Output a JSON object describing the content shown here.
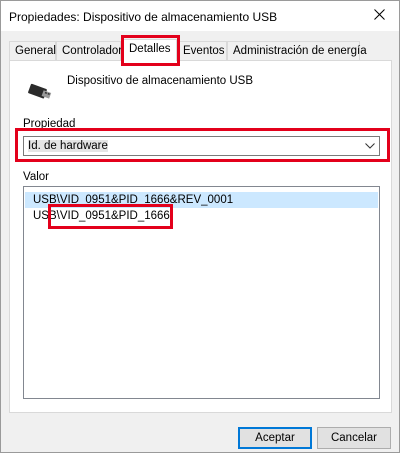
{
  "window": {
    "title": "Propiedades: Dispositivo de almacenamiento USB",
    "close_glyph": "✕"
  },
  "tabs": [
    {
      "label": "General",
      "active": false
    },
    {
      "label": "Controlador",
      "active": false
    },
    {
      "label": "Detalles",
      "active": true
    },
    {
      "label": "Eventos",
      "active": false
    },
    {
      "label": "Administración de energía",
      "active": false
    }
  ],
  "details": {
    "device_name": "Dispositivo de almacenamiento USB",
    "property_label": "Propiedad",
    "property_selected": "Id. de hardware",
    "value_label": "Valor",
    "values": [
      {
        "text": "USB\\VID_0951&PID_1666&REV_0001",
        "selected": true
      },
      {
        "text": "USB\\VID_0951&PID_1666",
        "selected": false
      }
    ]
  },
  "buttons": {
    "ok": "Aceptar",
    "cancel": "Cancelar"
  },
  "icons": {
    "device": "usb-drive-icon",
    "close": "close-icon",
    "dropdown": "chevron-down-icon"
  },
  "colors": {
    "highlight": "#e3001b",
    "selection": "#cce8ff",
    "default_button_border": "#0078d7"
  }
}
